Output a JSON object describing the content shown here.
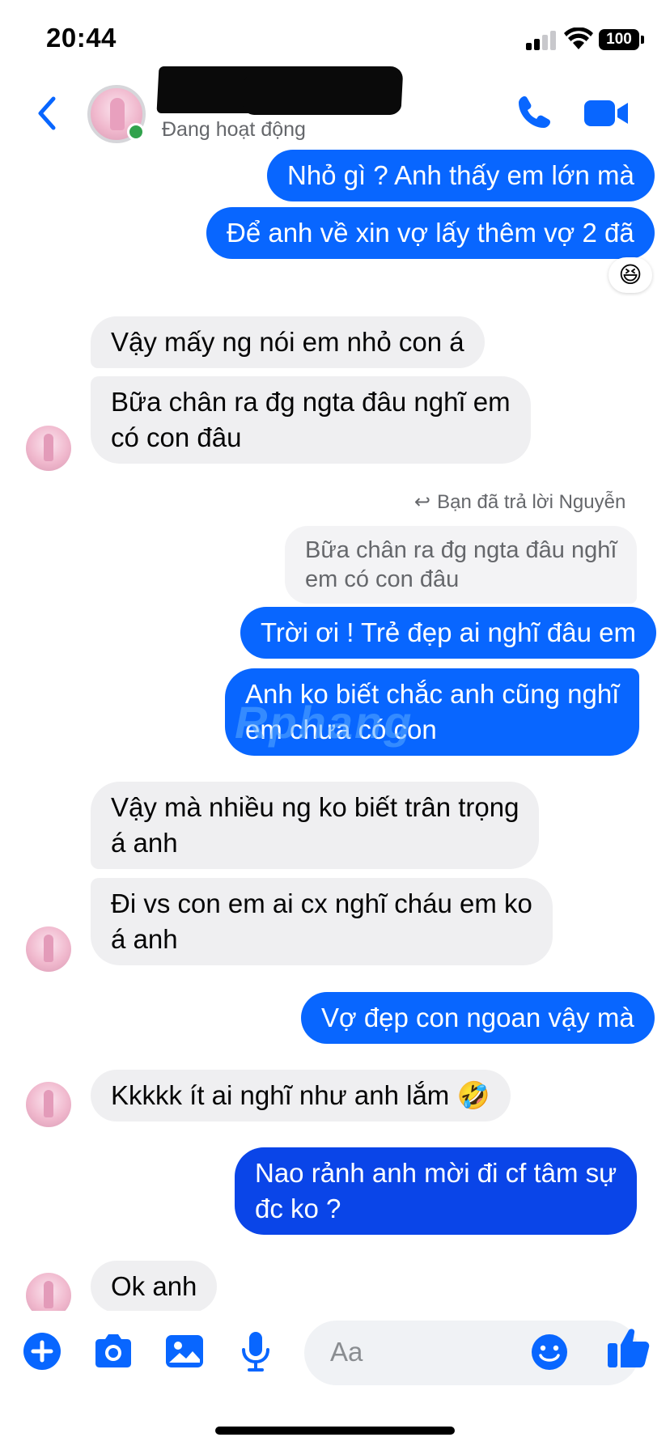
{
  "status_bar": {
    "time": "20:44",
    "battery": "100"
  },
  "header": {
    "contact_name": "",
    "status": "Đang hoạt động"
  },
  "colors": {
    "accent": "#0866ff",
    "incoming_bubble": "#efeff1",
    "online": "#31a24c"
  },
  "messages": [
    {
      "dir": "out",
      "text": "Nhỏ gì ? Anh thấy em lớn mà"
    },
    {
      "dir": "out",
      "text": "Để anh về xin vợ lấy thêm vợ 2 đã",
      "reaction": "😆"
    },
    {
      "dir": "in",
      "text": "Vậy mấy ng nói em nhỏ con á"
    },
    {
      "dir": "in",
      "lines": [
        "Bữa chân ra đg ngta đâu nghĩ em",
        "có con đâu"
      ]
    },
    {
      "dir": "out",
      "reply_note": "Bạn đã trả lời Nguyễn",
      "quote_lines": [
        "Bữa chân ra đg ngta đâu nghĩ",
        "em có con đâu"
      ],
      "text": "Trời ơi ! Trẻ đẹp ai nghĩ đâu em"
    },
    {
      "dir": "out",
      "lines": [
        "Anh ko biết chắc anh cũng nghĩ",
        "em chưa có con"
      ]
    },
    {
      "dir": "in",
      "lines": [
        "Vậy mà nhiều ng ko biết trân trọng",
        "á anh"
      ]
    },
    {
      "dir": "in",
      "lines": [
        "Đi vs con em ai cx nghĩ cháu em ko",
        "á anh"
      ]
    },
    {
      "dir": "out",
      "text": "Vợ đẹp con ngoan vậy mà"
    },
    {
      "dir": "in",
      "text": "Kkkkk ít ai nghĩ như anh lắm 🤣"
    },
    {
      "dir": "out",
      "lines": [
        "Nao rảnh anh mời đi cf tâm sự",
        "đc ko ?"
      ]
    },
    {
      "dir": "in",
      "text": "Ok anh"
    }
  ],
  "watermark": "Rphang",
  "composer": {
    "placeholder": "Aa"
  },
  "icons": [
    "back-arrow",
    "phone",
    "video-camera",
    "plus-circle",
    "camera",
    "image",
    "microphone",
    "smiley",
    "thumbs-up"
  ]
}
